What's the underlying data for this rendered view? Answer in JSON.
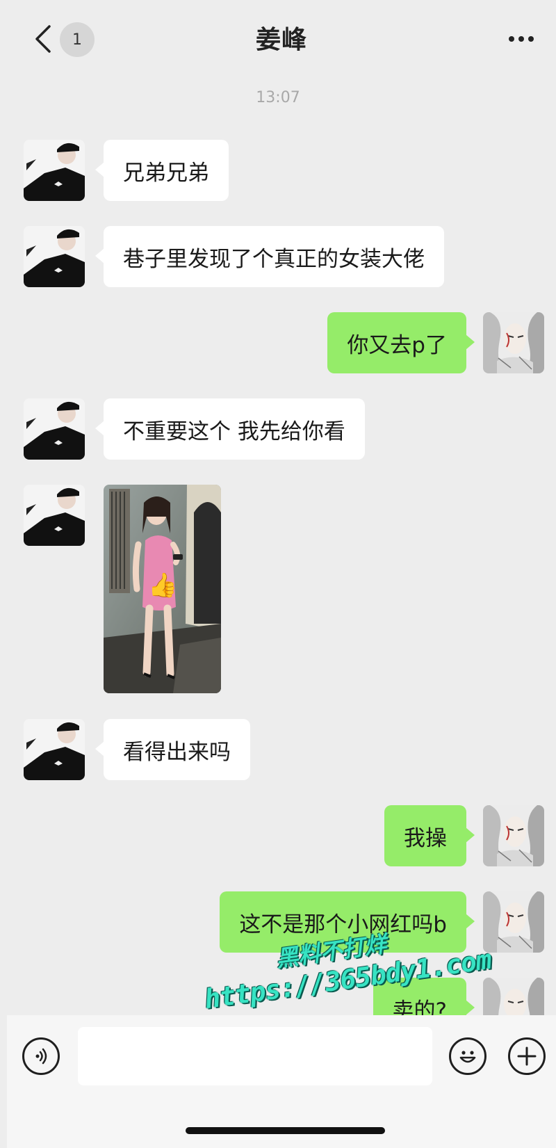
{
  "header": {
    "title": "姜峰",
    "unread_badge": "1",
    "back_icon": "chevron-left-icon",
    "more_icon": "more-horizontal-icon"
  },
  "timestamp": "13:07",
  "messages": [
    {
      "side": "incoming",
      "type": "text",
      "text": "兄弟兄弟"
    },
    {
      "side": "incoming",
      "type": "text",
      "text": "巷子里发现了个真正的女装大佬"
    },
    {
      "side": "outgoing",
      "type": "text",
      "text": "你又去p了"
    },
    {
      "side": "incoming",
      "type": "text",
      "text": "不重要这个 我先给你看"
    },
    {
      "side": "incoming",
      "type": "image",
      "description_icon": "photo-thumbnail-icon",
      "sticker": "👍"
    },
    {
      "side": "incoming",
      "type": "text",
      "text": "看得出来吗"
    },
    {
      "side": "outgoing",
      "type": "text",
      "text": "我操"
    },
    {
      "side": "outgoing",
      "type": "text",
      "text": "这不是那个小网红吗b"
    },
    {
      "side": "outgoing",
      "type": "text",
      "text": "卖的?"
    }
  ],
  "input_bar": {
    "voice_icon": "voice-icon",
    "emoji_icon": "emoji-icon",
    "plus_icon": "plus-icon",
    "message_value": ""
  },
  "watermark": {
    "line1": "黑料不打烊",
    "line2": "https://365bdy1.com"
  },
  "colors": {
    "background": "#ededed",
    "outgoing_bubble": "#95ec69",
    "incoming_bubble": "#ffffff",
    "watermark": "#37e3c3"
  }
}
